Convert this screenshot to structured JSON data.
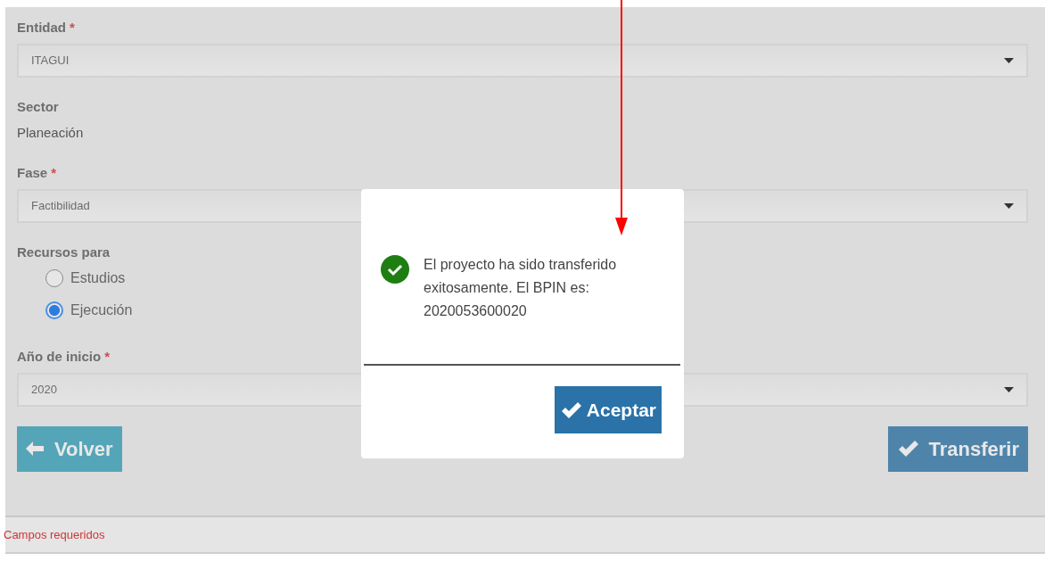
{
  "form": {
    "fields": [
      {
        "kind": "select",
        "label": "Entidad",
        "required_mark": "*",
        "value": "ITAGUI"
      },
      {
        "kind": "static",
        "label": "Sector",
        "value": "Planeación"
      },
      {
        "kind": "select",
        "label": "Fase",
        "required_mark": "*",
        "value": "Factibilidad"
      },
      {
        "kind": "radio",
        "label": "Recursos para",
        "options": [
          {
            "label": "Estudios",
            "selected": false
          },
          {
            "label": "Ejecución",
            "selected": true
          }
        ]
      },
      {
        "kind": "select",
        "label": "Año de inicio",
        "required_mark": "*",
        "value": "2020"
      }
    ],
    "buttons": [
      {
        "kind": "back",
        "label": "Volver"
      },
      {
        "kind": "confirm",
        "label": "Transferir"
      }
    ]
  },
  "footer": {
    "note": "Campos requeridos"
  },
  "dialog": {
    "kind": "success",
    "message": "El proyecto ha sido transferido exitosamente. El BPIN es: 2020053600020",
    "button": "Aceptar"
  }
}
